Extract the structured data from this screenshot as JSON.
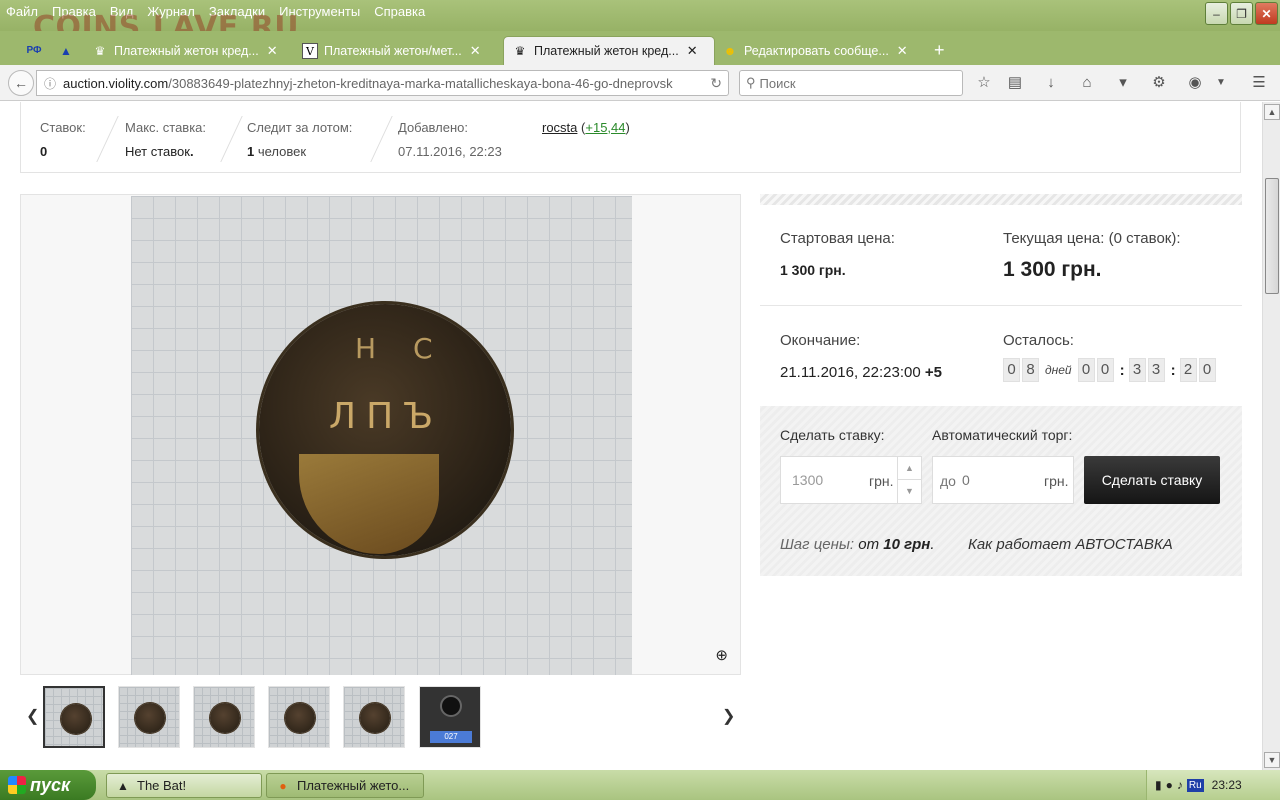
{
  "browser": {
    "menu": [
      "Файл",
      "Правка",
      "Вид",
      "Журнал",
      "Закладки",
      "Инструменты",
      "Справка"
    ],
    "watermark": "COINS.LAVE.RU",
    "tabs": [
      {
        "label": "Платежный жетон кред...",
        "icon": "crown-icon"
      },
      {
        "label": "Платежный жетон/мет...",
        "icon": "v-icon"
      },
      {
        "label": "Платежный жетон кред...",
        "icon": "crown-icon",
        "active": true
      },
      {
        "label": "Редактировать сообще...",
        "icon": "smiley-icon"
      }
    ],
    "new_tab": "+",
    "url_host": "auction.violity.com",
    "url_path": "/30883649-platezhnyj-zheton-kreditnaya-marka-matallicheskaya-bona-46-go-dneprovsk",
    "search_placeholder": "Поиск"
  },
  "lot_stats": {
    "bids_label": "Ставок:",
    "bids_value": "0",
    "max_bid_label": "Макс. ставка:",
    "max_bid_value": "Нет ставок",
    "watchers_label": "Следит за лотом:",
    "watchers_count": "1",
    "watchers_unit": "человек",
    "added_label": "Добавлено:",
    "added_value": "07.11.2016, 22:23",
    "seller_name": "rocsta",
    "seller_rating": "+15,44"
  },
  "photo": {
    "coin_text_top": "Н С",
    "coin_text_mid": "ЛПЪ"
  },
  "thumbnails": {
    "scale_reading": "027"
  },
  "price": {
    "start_label": "Стартовая цена:",
    "start_value": "1 300 грн.",
    "current_label": "Текущая цена: (0 ставок):",
    "current_value": "1 300 грн.",
    "end_label": "Окончание:",
    "end_value": "21.11.2016, 22:23:00",
    "end_tz": "+5",
    "left_label": "Осталось:",
    "timer": {
      "d1": "0",
      "d2": "8",
      "days": "дней",
      "h1": "0",
      "h2": "0",
      "m1": "3",
      "m2": "3",
      "s1": "2",
      "s2": "0"
    }
  },
  "bid": {
    "make_bid_label": "Сделать ставку:",
    "bid_value": "1300",
    "currency": "грн.",
    "auto_label": "Автоматический торг:",
    "auto_prefix": "до",
    "auto_placeholder": "0",
    "button": "Сделать ставку",
    "step_label": "Шаг цены:",
    "step_from": "от",
    "step_value": "10 грн",
    "how_auto": "Как работает АВТОСТАВКА"
  },
  "taskbar": {
    "start": "пуск",
    "tasks": [
      "The Bat!",
      "Платежный жето..."
    ],
    "lang": "Ru",
    "clock": "23:23"
  }
}
